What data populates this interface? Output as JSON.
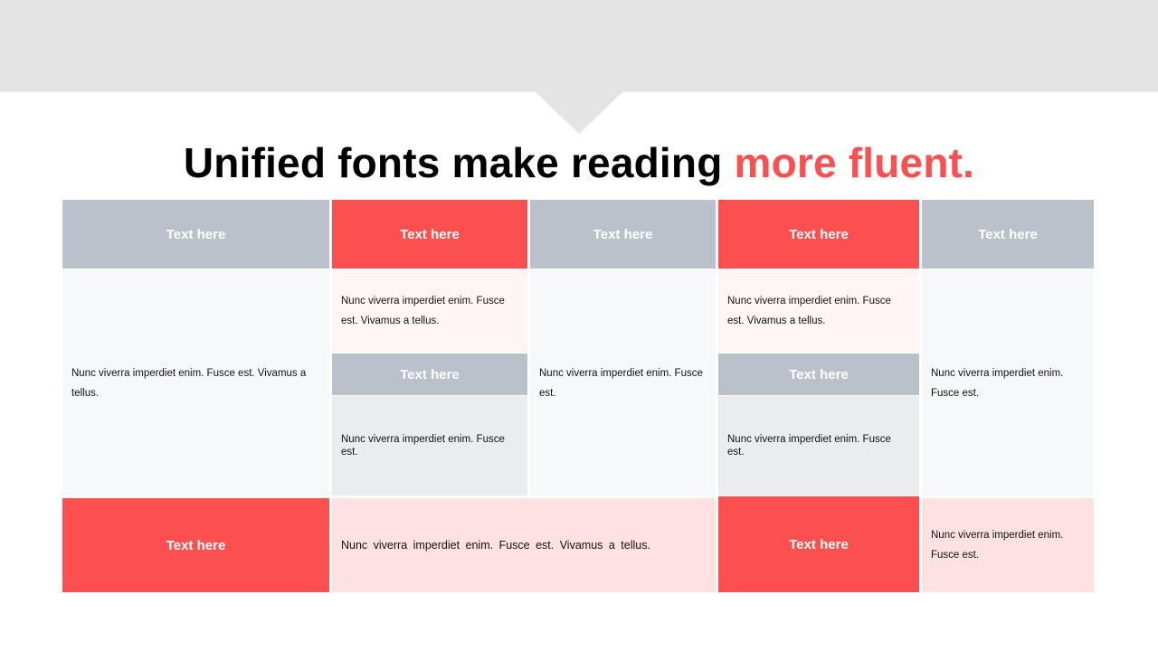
{
  "title": {
    "main": "Unified fonts make reading ",
    "accent": "more fluent."
  },
  "headers": {
    "col1": "Text here",
    "col2": "Text here",
    "col3": "Text here",
    "col4": "Text here",
    "col5": "Text here",
    "col2_mid": "Text here",
    "col4_mid": "Text here",
    "bottom1": "Text here",
    "bottom4": "Text here"
  },
  "body": {
    "col1": "Nunc viverra imperdiet enim. Fusce est. Vivamus a tellus.",
    "col2_top": "Nunc viverra imperdiet enim. Fusce est. Vivamus a tellus.",
    "col2_bottom": "Nunc viverra imperdiet enim. Fusce est.",
    "col3": "Nunc viverra imperdiet enim. Fusce est.",
    "col4_top": "Nunc viverra imperdiet enim. Fusce est. Vivamus a tellus.",
    "col4_bottom": "Nunc viverra imperdiet enim. Fusce est.",
    "col5": "Nunc viverra imperdiet enim. Fusce est.",
    "bottom_wide": "Nunc viverra imperdiet enim. Fusce est. Vivamus a tellus.",
    "bottom_right": "Nunc viverra imperdiet enim. Fusce est."
  },
  "colors": {
    "accent": "#fc4f4f",
    "header_gray": "#bac1ca",
    "band_gray": "#e4e4e4",
    "pink": "#ffe1e2"
  }
}
